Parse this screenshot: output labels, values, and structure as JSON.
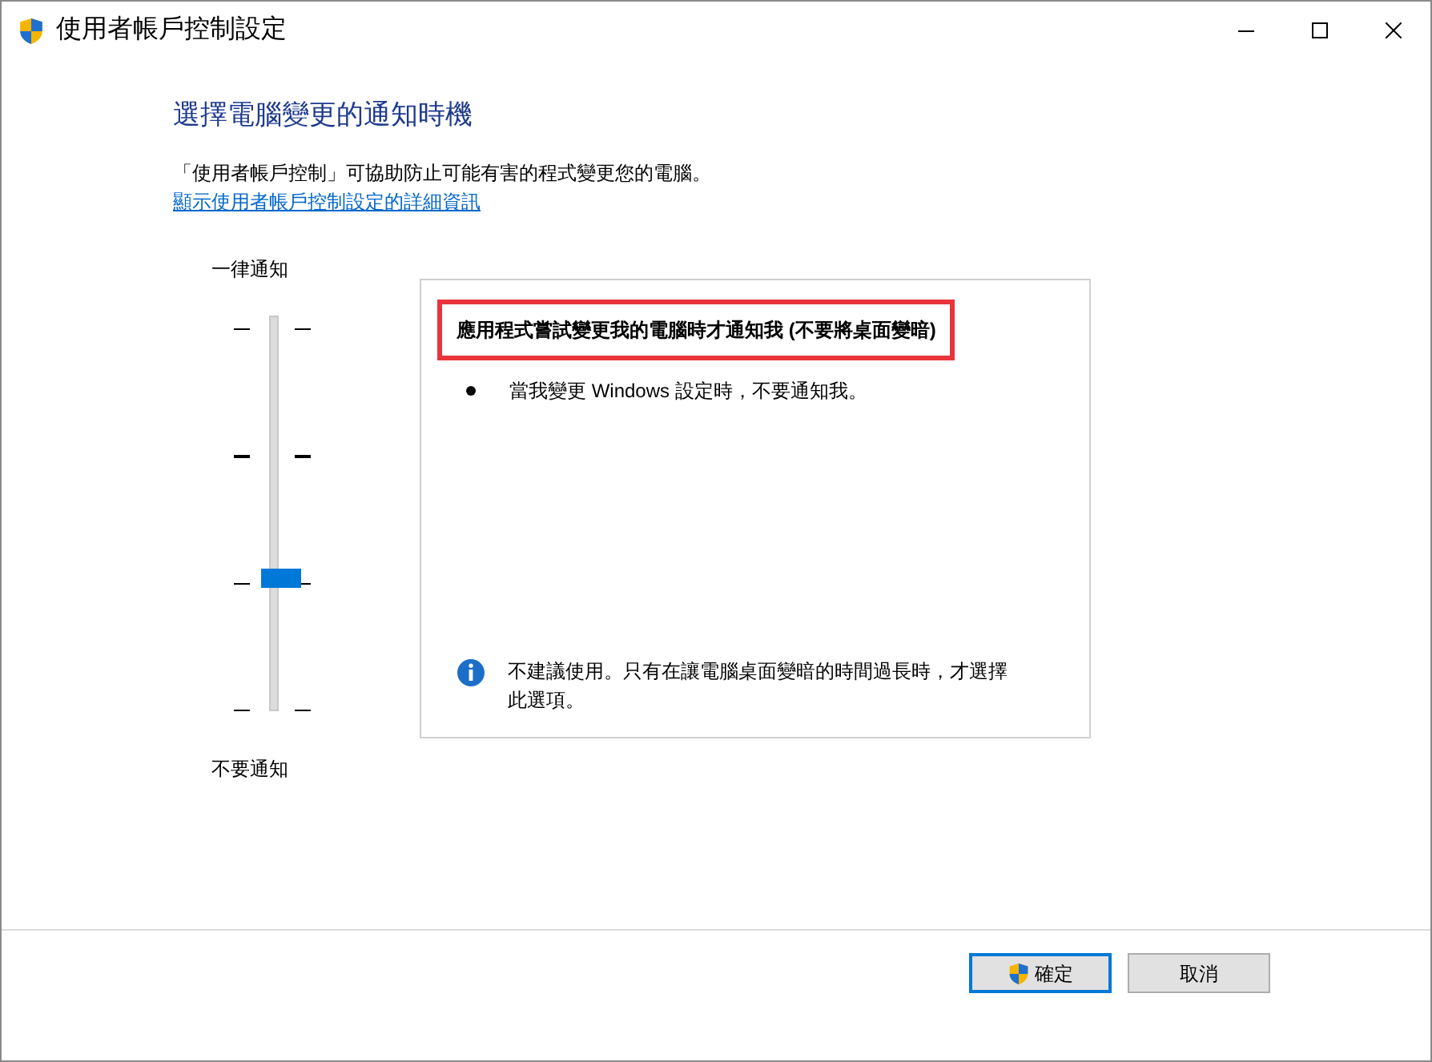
{
  "window": {
    "title": "使用者帳戶控制設定"
  },
  "heading": "選擇電腦變更的通知時機",
  "description": "「使用者帳戶控制」可協助防止可能有害的程式變更您的電腦。",
  "details_link": "顯示使用者帳戶控制設定的詳細資訊",
  "slider": {
    "top_label": "一律通知",
    "bottom_label": "不要通知",
    "level": 0.33
  },
  "panel": {
    "title": "應用程式嘗試變更我的電腦時才通知我 (不要將桌面變暗)",
    "highlighted": true,
    "bullets": [
      "當我變更 Windows 設定時，不要通知我。"
    ],
    "note": "不建議使用。只有在讓電腦桌面變暗的時間過長時，才選擇此選項。"
  },
  "buttons": [
    {
      "label": "確定",
      "default": true,
      "shield": true
    },
    {
      "label": "取消",
      "default": false,
      "shield": false
    }
  ]
}
